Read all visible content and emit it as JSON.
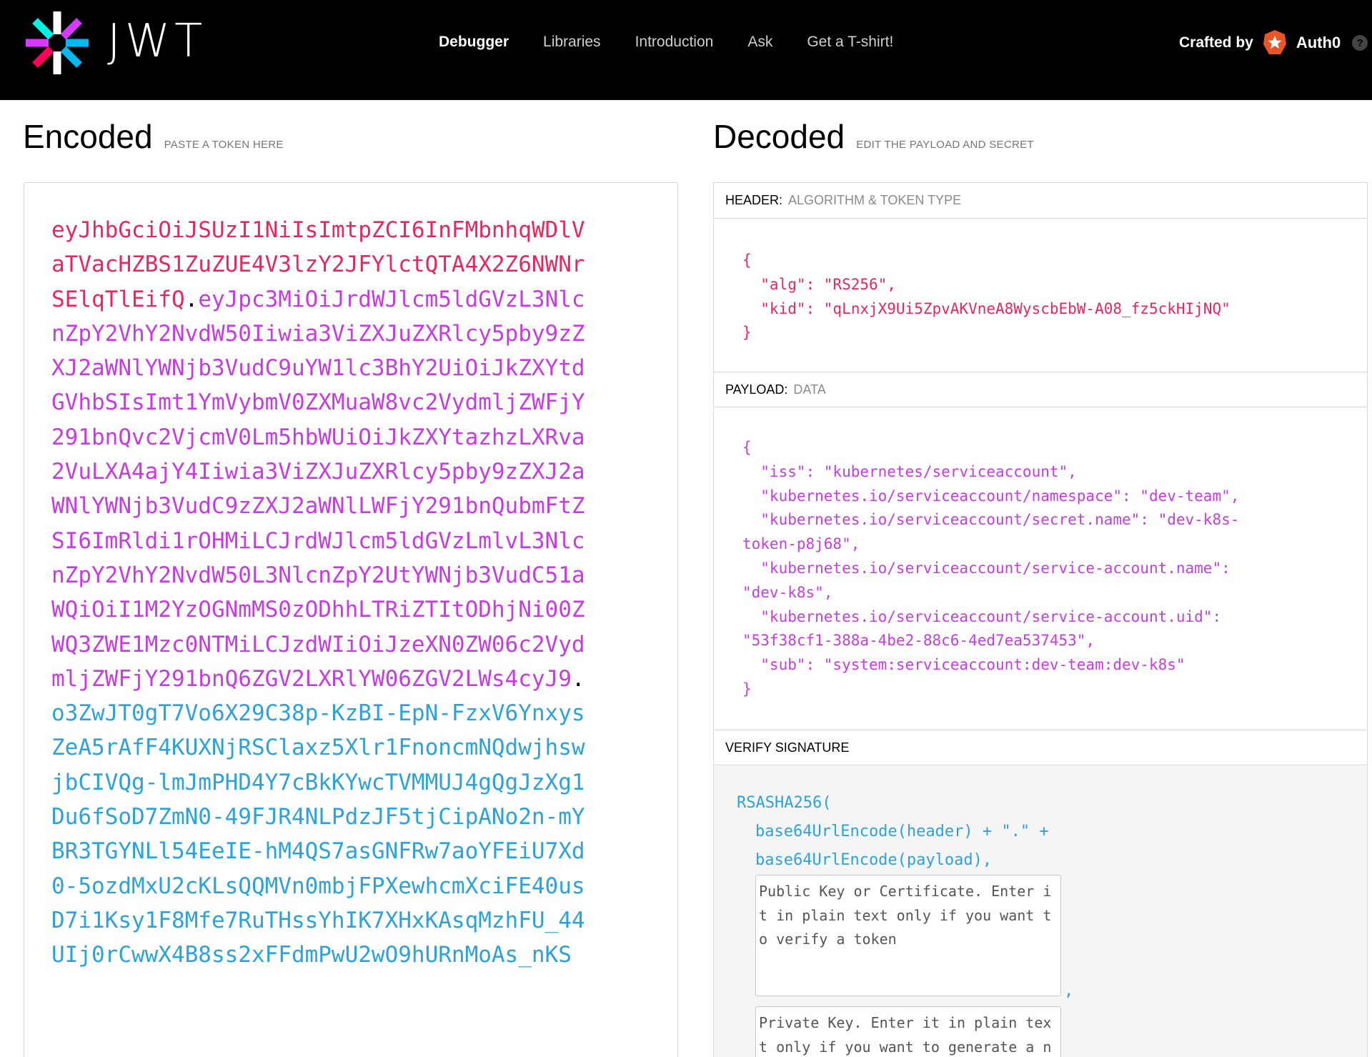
{
  "nav": {
    "brand": "JWT",
    "links": [
      "Debugger",
      "Libraries",
      "Introduction",
      "Ask",
      "Get a T-shirt!"
    ],
    "crafted_label": "Crafted by",
    "crafted_brand": "Auth0",
    "help": "?"
  },
  "encoded": {
    "title": "Encoded",
    "subtitle": "PASTE A TOKEN HERE",
    "token_header": "eyJhbGciOiJSUzI1NiIsImtpZCI6InFMbnhqWDlVaTVacHZBS1ZuZUE4V3lzY2JFYlctQTA4X2Z6NWNrSElqTlEifQ",
    "dot1": ".",
    "token_payload": "eyJpc3MiOiJrdWJlcm5ldGVzL3NlcnZpY2VhY2NvdW50Iiwia3ViZXJuZXRlcy5pby9zZXJ2aWNlYWNjb3VudC9uYW1lc3BhY2UiOiJkZXYtdGVhbSIsImt1YmVybmV0ZXMuaW8vc2VydmljZWFjY291bnQvc2VjcmV0Lm5hbWUiOiJkZXYtazhzLXRva2VuLXA4ajY4Iiwia3ViZXJuZXRlcy5pby9zZXJ2aWNlYWNjb3VudC9zZXJ2aWNlLWFjY291bnQubmFtZSI6ImRldi1rOHMiLCJrdWJlcm5ldGVzLmlvL3NlcnZpY2VhY2NvdW50L3NlcnZpY2UtYWNjb3VudC51aWQiOiI1M2YzOGNmMS0zODhhLTRiZTItODhjNi00ZWQ3ZWE1Mzc0NTMiLCJzdWIiOiJzeXN0ZW06c2VydmljZWFjY291bnQ6ZGV2LXRlYW06ZGV2LWs4cyJ9",
    "dot2": ".",
    "token_signature": "o3ZwJT0gT7Vo6X29C38p-KzBI-EpN-FzxV6YnxysZeA5rAfF4KUXNjRSClaxz5Xlr1FnoncmNQdwjhswjbCIVQg-lmJmPHD4Y7cBkKYwcTVMMUJ4gQgJzXg1Du6fSoD7ZmN0-49FJR4NLPdzJF5tjCipANo2n-mYBR3TGYNLl54EeIE-hM4QS7asGNFRw7aoYFEiU7Xd0-5ozdMxU2cKLsQQMVn0mbjFPXewhcmXciFE40usD7i1Ksy1F8Mfe7RuTHssYhIK7XHxKAsqMzhFU_44UIj0rCwwX4B8ss2xFFdmPwU2wO9hURnMoAs_nKS"
  },
  "decoded": {
    "title": "Decoded",
    "subtitle": "EDIT THE PAYLOAD AND SECRET",
    "header_label": "HEADER:",
    "header_sub": "ALGORITHM & TOKEN TYPE",
    "header_json": "{\n  \"alg\": \"RS256\",\n  \"kid\": \"qLnxjX9Ui5ZpvAKVneA8WyscbEbW-A08_fz5ckHIjNQ\"\n}",
    "payload_label": "PAYLOAD:",
    "payload_sub": "DATA",
    "payload_json": "{\n  \"iss\": \"kubernetes/serviceaccount\",\n  \"kubernetes.io/serviceaccount/namespace\": \"dev-team\",\n  \"kubernetes.io/serviceaccount/secret.name\": \"dev-k8s-\ntoken-p8j68\",\n  \"kubernetes.io/serviceaccount/service-account.name\":\n\"dev-k8s\",\n  \"kubernetes.io/serviceaccount/service-account.uid\":\n\"53f38cf1-388a-4be2-88c6-4ed7ea537453\",\n  \"sub\": \"system:serviceaccount:dev-team:dev-k8s\"\n}",
    "verify_label": "VERIFY SIGNATURE",
    "sig_line1": "RSASHA256(",
    "sig_line2": "base64UrlEncode(header) + \".\" +",
    "sig_line3": "base64UrlEncode(payload),",
    "public_key_placeholder": "Public Key or Certificate. Enter it in plain text only if you want to verify a token",
    "comma": ",",
    "private_key_placeholder": "Private Key. Enter it in plain text only if you want to generate a new token"
  },
  "colors": {
    "header": "#e8275d",
    "payload": "#c63be2",
    "signature": "#2ba2db"
  }
}
